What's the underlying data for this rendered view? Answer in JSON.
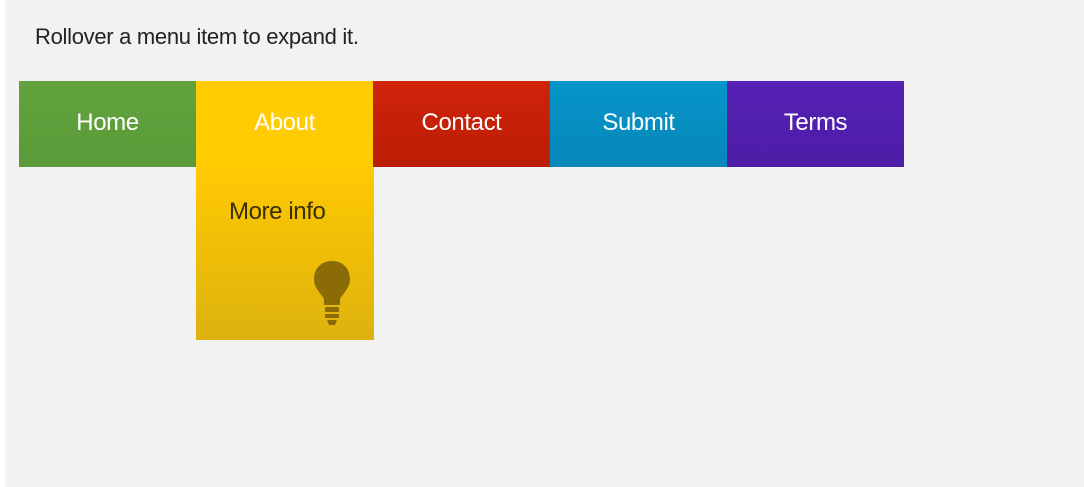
{
  "instruction": "Rollover a menu item to expand it.",
  "menu": {
    "items": [
      {
        "label": "Home",
        "color": "#5f9f3c"
      },
      {
        "label": "About",
        "color": "#ffcb02"
      },
      {
        "label": "Contact",
        "color": "#c8200a"
      },
      {
        "label": "Submit",
        "color": "#068fc2"
      },
      {
        "label": "Terms",
        "color": "#5320b0"
      }
    ],
    "active_index": 1
  },
  "dropdown": {
    "label": "More info",
    "icon": "lightbulb-icon"
  }
}
